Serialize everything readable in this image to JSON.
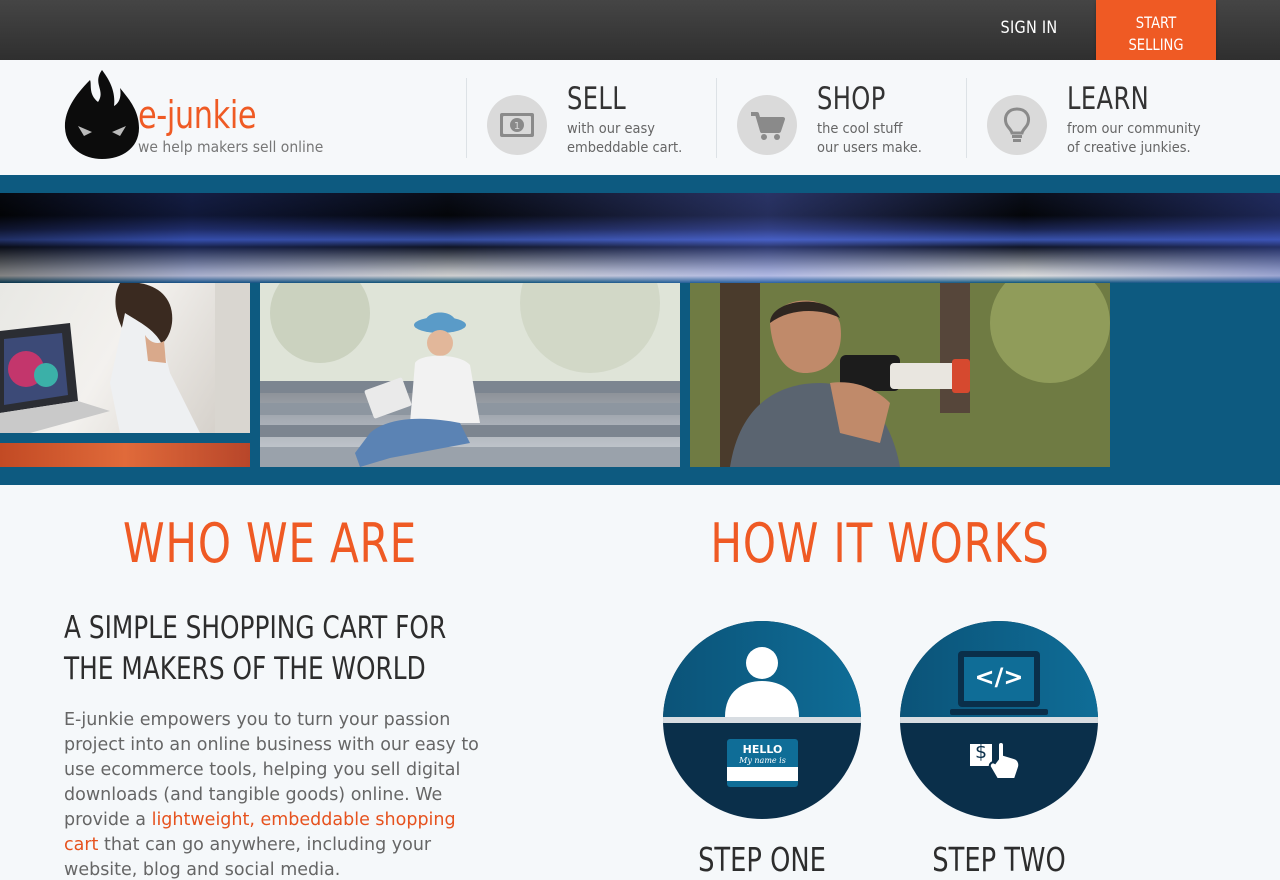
{
  "topbar": {
    "sign_in": "SIGN IN",
    "start_selling_line1": "START",
    "start_selling_line2": "SELLING"
  },
  "header": {
    "brand": "e-junkie",
    "tagline": "we help makers sell online",
    "nav": [
      {
        "title": "SELL",
        "desc_line1": "with our easy",
        "desc_line2": "embeddable cart.",
        "icon": "money-bill-icon"
      },
      {
        "title": "SHOP",
        "desc_line1": "the cool stuff",
        "desc_line2": "our users make.",
        "icon": "shopping-cart-icon"
      },
      {
        "title": "LEARN",
        "desc_line1": "from our community",
        "desc_line2": "of creative junkies.",
        "icon": "lightbulb-icon"
      }
    ]
  },
  "who": {
    "title": "WHO WE ARE",
    "subhead_line1": "A SIMPLE SHOPPING CART FOR",
    "subhead_line2": "THE MAKERS OF THE WORLD",
    "para_before": "E-junkie empowers you to turn your passion project into an online business with our easy to use ecommerce tools, helping you sell digital downloads (and tangible goods) online. We provide a ",
    "para_link": "lightweight, embeddable shopping cart",
    "para_after": " that can go anywhere, including your website, blog and social media."
  },
  "how": {
    "title": "HOW IT WORKS",
    "steps": [
      {
        "label": "STEP ONE",
        "badge_title": "HELLO",
        "badge_sub": "My name is"
      },
      {
        "label": "STEP TWO",
        "code_glyph": "</>",
        "dollar": "$"
      }
    ]
  },
  "colors": {
    "accent": "#ef5a24",
    "topbar": "#3a3a3a",
    "hero_bg": "#0d5a80",
    "step_dark": "#0a2f4a"
  }
}
